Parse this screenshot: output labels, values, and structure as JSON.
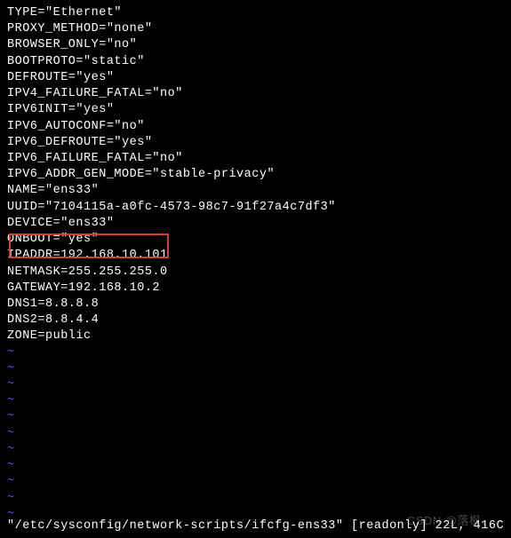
{
  "config_lines": [
    "TYPE=\"Ethernet\"",
    "PROXY_METHOD=\"none\"",
    "BROWSER_ONLY=\"no\"",
    "BOOTPROTO=\"static\"",
    "DEFROUTE=\"yes\"",
    "IPV4_FAILURE_FATAL=\"no\"",
    "IPV6INIT=\"yes\"",
    "IPV6_AUTOCONF=\"no\"",
    "IPV6_DEFROUTE=\"yes\"",
    "IPV6_FAILURE_FATAL=\"no\"",
    "IPV6_ADDR_GEN_MODE=\"stable-privacy\"",
    "NAME=\"ens33\"",
    "UUID=\"7104115a-a0fc-4573-98c7-91f27a4c7df3\"",
    "DEVICE=\"ens33\"",
    "ONBOOT=\"yes\"",
    "",
    "IPADDR=192.168.10.101",
    "NETMASK=255.255.255.0",
    "GATEWAY=192.168.10.2",
    "DNS1=8.8.8.8",
    "DNS2=8.8.4.4",
    "ZONE=public"
  ],
  "tilde_count": 11,
  "tilde_char": "~",
  "status": "\"/etc/sysconfig/network-scripts/ifcfg-ens33\" [readonly] 22L, 416C",
  "watermark": "CSDN @落枫、"
}
